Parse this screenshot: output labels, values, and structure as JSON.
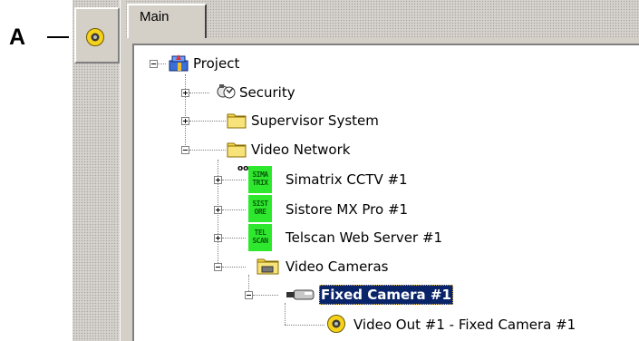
{
  "callout": {
    "letter": "A"
  },
  "tabs": [
    {
      "label": "Main"
    }
  ],
  "tree": {
    "project": "Project",
    "security": "Security",
    "supervisor": "Supervisor System",
    "video_network": "Video Network",
    "simatrix": "Simatrix CCTV #1",
    "sistore": "Sistore MX Pro #1",
    "telscan": "Telscan Web Server #1",
    "video_cameras": "Video Cameras",
    "fixed_camera": "Fixed Camera #1",
    "video_out": "Video Out #1 - Fixed Camera #1"
  },
  "badges": {
    "simatrix": [
      "SIMA",
      "TRIX"
    ],
    "sistore": [
      "SIST",
      "ORE"
    ],
    "telscan": [
      "TEL",
      "SCAN"
    ]
  },
  "colors": {
    "selection_bg": "#0a246a",
    "badge_green": "#2ee82e",
    "folder_yellow": "#f5d84a",
    "sensor_yellow": "#f7d21a"
  },
  "icons": {
    "side_button": "video-output-icon",
    "project": "project-icon",
    "security": "security-icon",
    "folder": "folder-icon",
    "camera": "camera-icon"
  }
}
